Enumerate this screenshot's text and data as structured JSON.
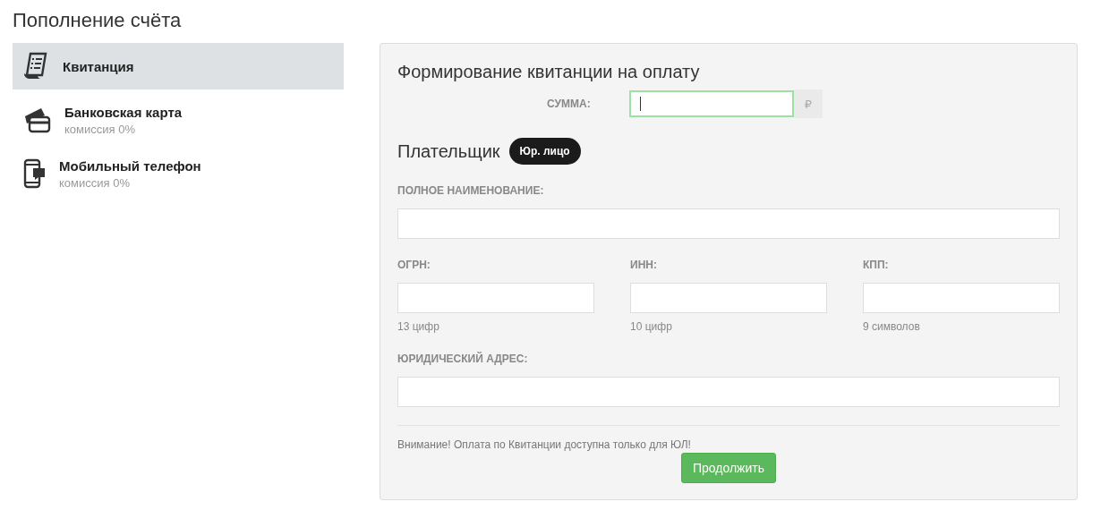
{
  "page_title": "Пополнение счёта",
  "methods": [
    {
      "kind": "receipt",
      "label": "Квитанция",
      "selected": true
    },
    {
      "kind": "card",
      "label": "Банковская карта",
      "note": "комиссия 0%",
      "selected": false
    },
    {
      "kind": "phone",
      "label": "Мобильный телефон",
      "note": "комиссия 0%",
      "selected": false
    }
  ],
  "form": {
    "title": "Формирование квитанции на оплату",
    "amount": {
      "label": "СУММА:",
      "focused": true,
      "currency": "₽"
    },
    "payer": {
      "label": "Плательщик",
      "type_badge": "Юр. лицо"
    },
    "fields": [
      {
        "label": "ПОЛНОЕ НАИМЕНОВАНИЕ:",
        "kind": "wide"
      },
      {
        "label": "ОГРН:",
        "hint": "13 цифр",
        "kind": "third"
      },
      {
        "label": "ИНН:",
        "hint": "10 цифр",
        "kind": "third"
      },
      {
        "label": "КПП:",
        "hint": "9 символов",
        "kind": "third"
      },
      {
        "label": "ЮРИДИЧЕСКИЙ АДРЕС:",
        "kind": "wide"
      }
    ],
    "notice": "Внимание! Оплата по Квитанции доступна только для ЮЛ!",
    "submit": "Продолжить"
  }
}
